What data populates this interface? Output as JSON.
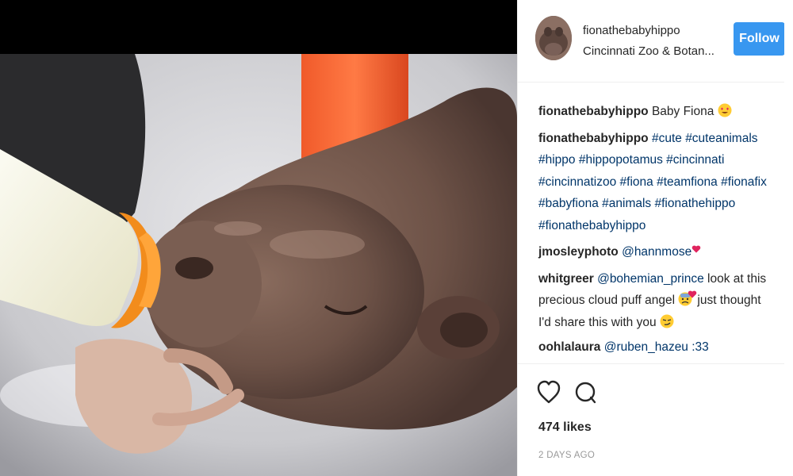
{
  "post": {
    "username": "fionathebabyhippo",
    "location": "Cincinnati Zoo & Botan...",
    "follow_label": "Follow",
    "likes": "474 likes",
    "date": "2 DAYS AGO"
  },
  "comments": {
    "c1": {
      "user": "fionathebabyhippo",
      "text": "Baby Fiona",
      "emoji": "heart-eyes-emoji"
    },
    "c2": {
      "user": "fionathebabyhippo",
      "tags": [
        "#cute",
        "#cuteanimals",
        "#hippo",
        "#hippopotamus",
        "#cincinnati",
        "#cincinnatizoo",
        "#fiona",
        "#teamfiona",
        "#fionafix",
        "#babyfiona",
        "#animals",
        "#fionathehippo",
        "#fionathebabyhippo"
      ]
    },
    "c3": {
      "user": "jmosleyphoto",
      "mention": "@hannmose",
      "emoji": "heart-emoji"
    },
    "c4": {
      "user": "whitgreer",
      "mention": "@bohemian_prince",
      "text_a": "look at this precious cloud puff angel",
      "text_b": "just thought I'd share this with you",
      "emojis": [
        "cold-sweat-emoji",
        "heart-emoji",
        "smirk-emoji"
      ]
    },
    "c5": {
      "user": "oohlalaura",
      "text": "@ruben_hazeu :33"
    }
  },
  "icons": {
    "like": "heart-outline-icon",
    "comment": "comment-bubble-icon"
  },
  "colors": {
    "follow": "#3897f0",
    "link": "#003569",
    "text": "#262626",
    "muted": "#999999"
  }
}
